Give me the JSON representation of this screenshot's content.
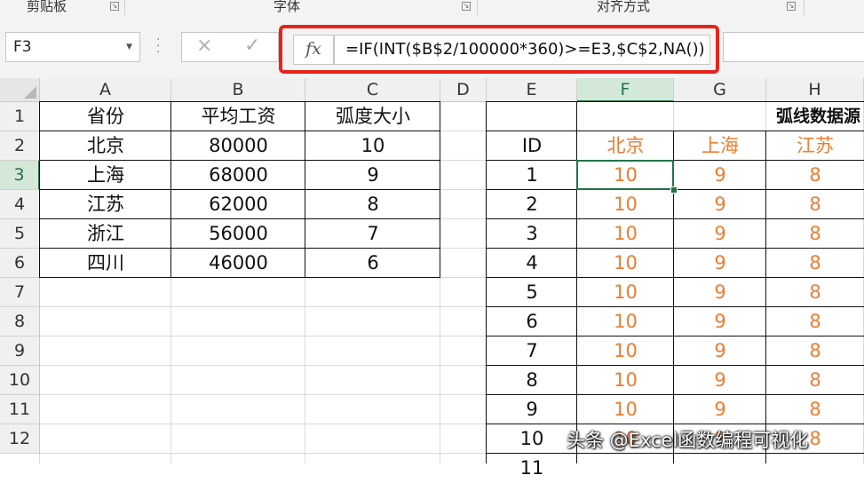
{
  "ribbon": {
    "groups": [
      "剪贴板",
      "字体",
      "对齐方式"
    ]
  },
  "formula_bar": {
    "name_box": "F3",
    "cancel_icon": "×",
    "confirm_icon": "✓",
    "fx_label": "fx",
    "formula": "=IF(INT($B$2/100000*360)>=E3,$C$2,NA())"
  },
  "columns": [
    "A",
    "B",
    "C",
    "D",
    "E",
    "F",
    "G",
    "H"
  ],
  "rows": [
    "1",
    "2",
    "3",
    "4",
    "5",
    "6",
    "7",
    "8",
    "9",
    "10",
    "11",
    "12"
  ],
  "left_table": {
    "headers": [
      "省份",
      "平均工资",
      "弧度大小"
    ],
    "rows": [
      [
        "北京",
        "80000",
        "10"
      ],
      [
        "上海",
        "68000",
        "9"
      ],
      [
        "江苏",
        "62000",
        "8"
      ],
      [
        "浙江",
        "56000",
        "7"
      ],
      [
        "四川",
        "46000",
        "6"
      ]
    ]
  },
  "right_table": {
    "title": "弧线数据源",
    "headers": [
      "ID",
      "北京",
      "上海",
      "江苏"
    ],
    "rows": [
      [
        "1",
        "10",
        "9",
        "8"
      ],
      [
        "2",
        "10",
        "9",
        "8"
      ],
      [
        "3",
        "10",
        "9",
        "8"
      ],
      [
        "4",
        "10",
        "9",
        "8"
      ],
      [
        "5",
        "10",
        "9",
        "8"
      ],
      [
        "6",
        "10",
        "9",
        "8"
      ],
      [
        "7",
        "10",
        "9",
        "8"
      ],
      [
        "8",
        "10",
        "9",
        "8"
      ],
      [
        "9",
        "10",
        "9",
        "8"
      ],
      [
        "10",
        "10",
        "9",
        "8"
      ]
    ]
  },
  "selected_cell": "F3",
  "watermark": "头条 @Excel函数编程可视化",
  "colors": {
    "accent_green": "#217346",
    "orange_text": "#ed7d31",
    "highlight_red": "#e8221b"
  }
}
